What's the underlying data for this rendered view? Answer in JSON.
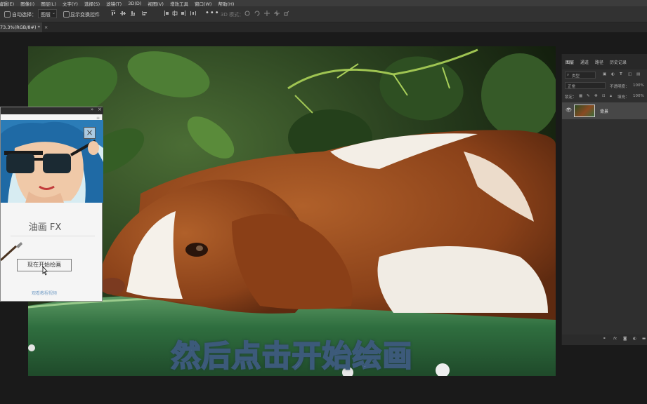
{
  "menu": [
    "编辑(E)",
    "图像(I)",
    "图层(L)",
    "文字(Y)",
    "选择(S)",
    "滤镜(T)",
    "3D(D)",
    "视图(V)",
    "增效工具",
    "窗口(W)",
    "帮助(H)"
  ],
  "options_bar": {
    "auto_select_label": "自动选择：",
    "auto_select_value": "图层",
    "show_transform_label": "显示变换控件",
    "mode_3d_label": "3D 模式："
  },
  "document": {
    "tab_title": "73.3%(RGB/8#) *"
  },
  "plugin": {
    "title": "油画 FX",
    "start_button": "现在开始绘画",
    "footer_link": "观看教程视频"
  },
  "layers_panel": {
    "tabs": [
      "图层",
      "通道",
      "路径",
      "历史记录"
    ],
    "filter_label": "类型",
    "blend_mode": "正常",
    "opacity_label": "不透明度：",
    "opacity_value": "100%",
    "lock_label": "锁定：",
    "fill_label": "填充：",
    "fill_value": "100%",
    "layer_name": "背景"
  },
  "subtitle": "然后点击开始绘画",
  "colors": {
    "accent": "#5a9bd3",
    "subtitle_text": "#dbe7f3",
    "subtitle_outline": "#3c5a7a"
  }
}
